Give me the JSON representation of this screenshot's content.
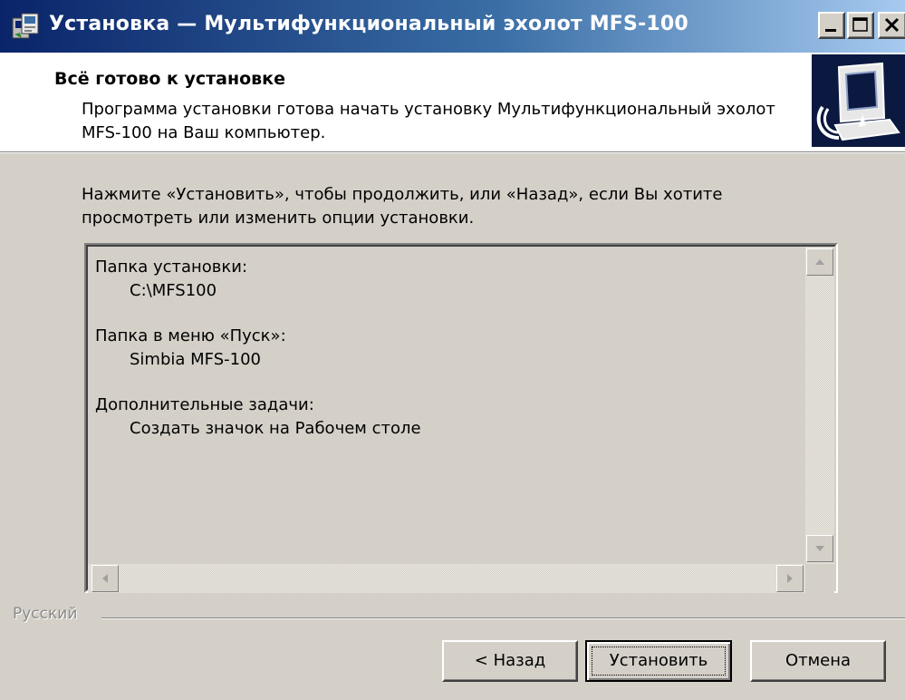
{
  "window": {
    "title": "Установка — Мультифункциональный эхолот MFS-100",
    "controls": {
      "minimize_icon": "minimize-icon",
      "maximize_icon": "maximize-icon",
      "close_icon": "close-icon"
    }
  },
  "header": {
    "title": "Всё готово к установке",
    "description": "Программа установки готова начать установку Мультифункциональный эхолот MFS-100 на Ваш компьютер.",
    "graphic_icon": "computer-install-icon"
  },
  "body": {
    "instruction": "Нажмите «Установить», чтобы продолжить, или «Назад», если Вы хотите просмотреть или изменить опции установки.",
    "summary": [
      {
        "heading": "Папка установки:",
        "value": "C:\\MFS100"
      },
      {
        "heading": "Папка в меню «Пуск»:",
        "value": "Simbia MFS-100"
      },
      {
        "heading": "Дополнительные задачи:",
        "value": "Создать значок на Рабочем столе"
      }
    ]
  },
  "footer": {
    "language": "Русский",
    "buttons": {
      "back": "< Назад",
      "install": "Установить",
      "cancel": "Отмена"
    }
  },
  "colors": {
    "title_gradient_start": "#0a246a",
    "title_gradient_end": "#a6caf0",
    "dialog_face": "#d4d0c8",
    "header_background": "#ffffff"
  }
}
